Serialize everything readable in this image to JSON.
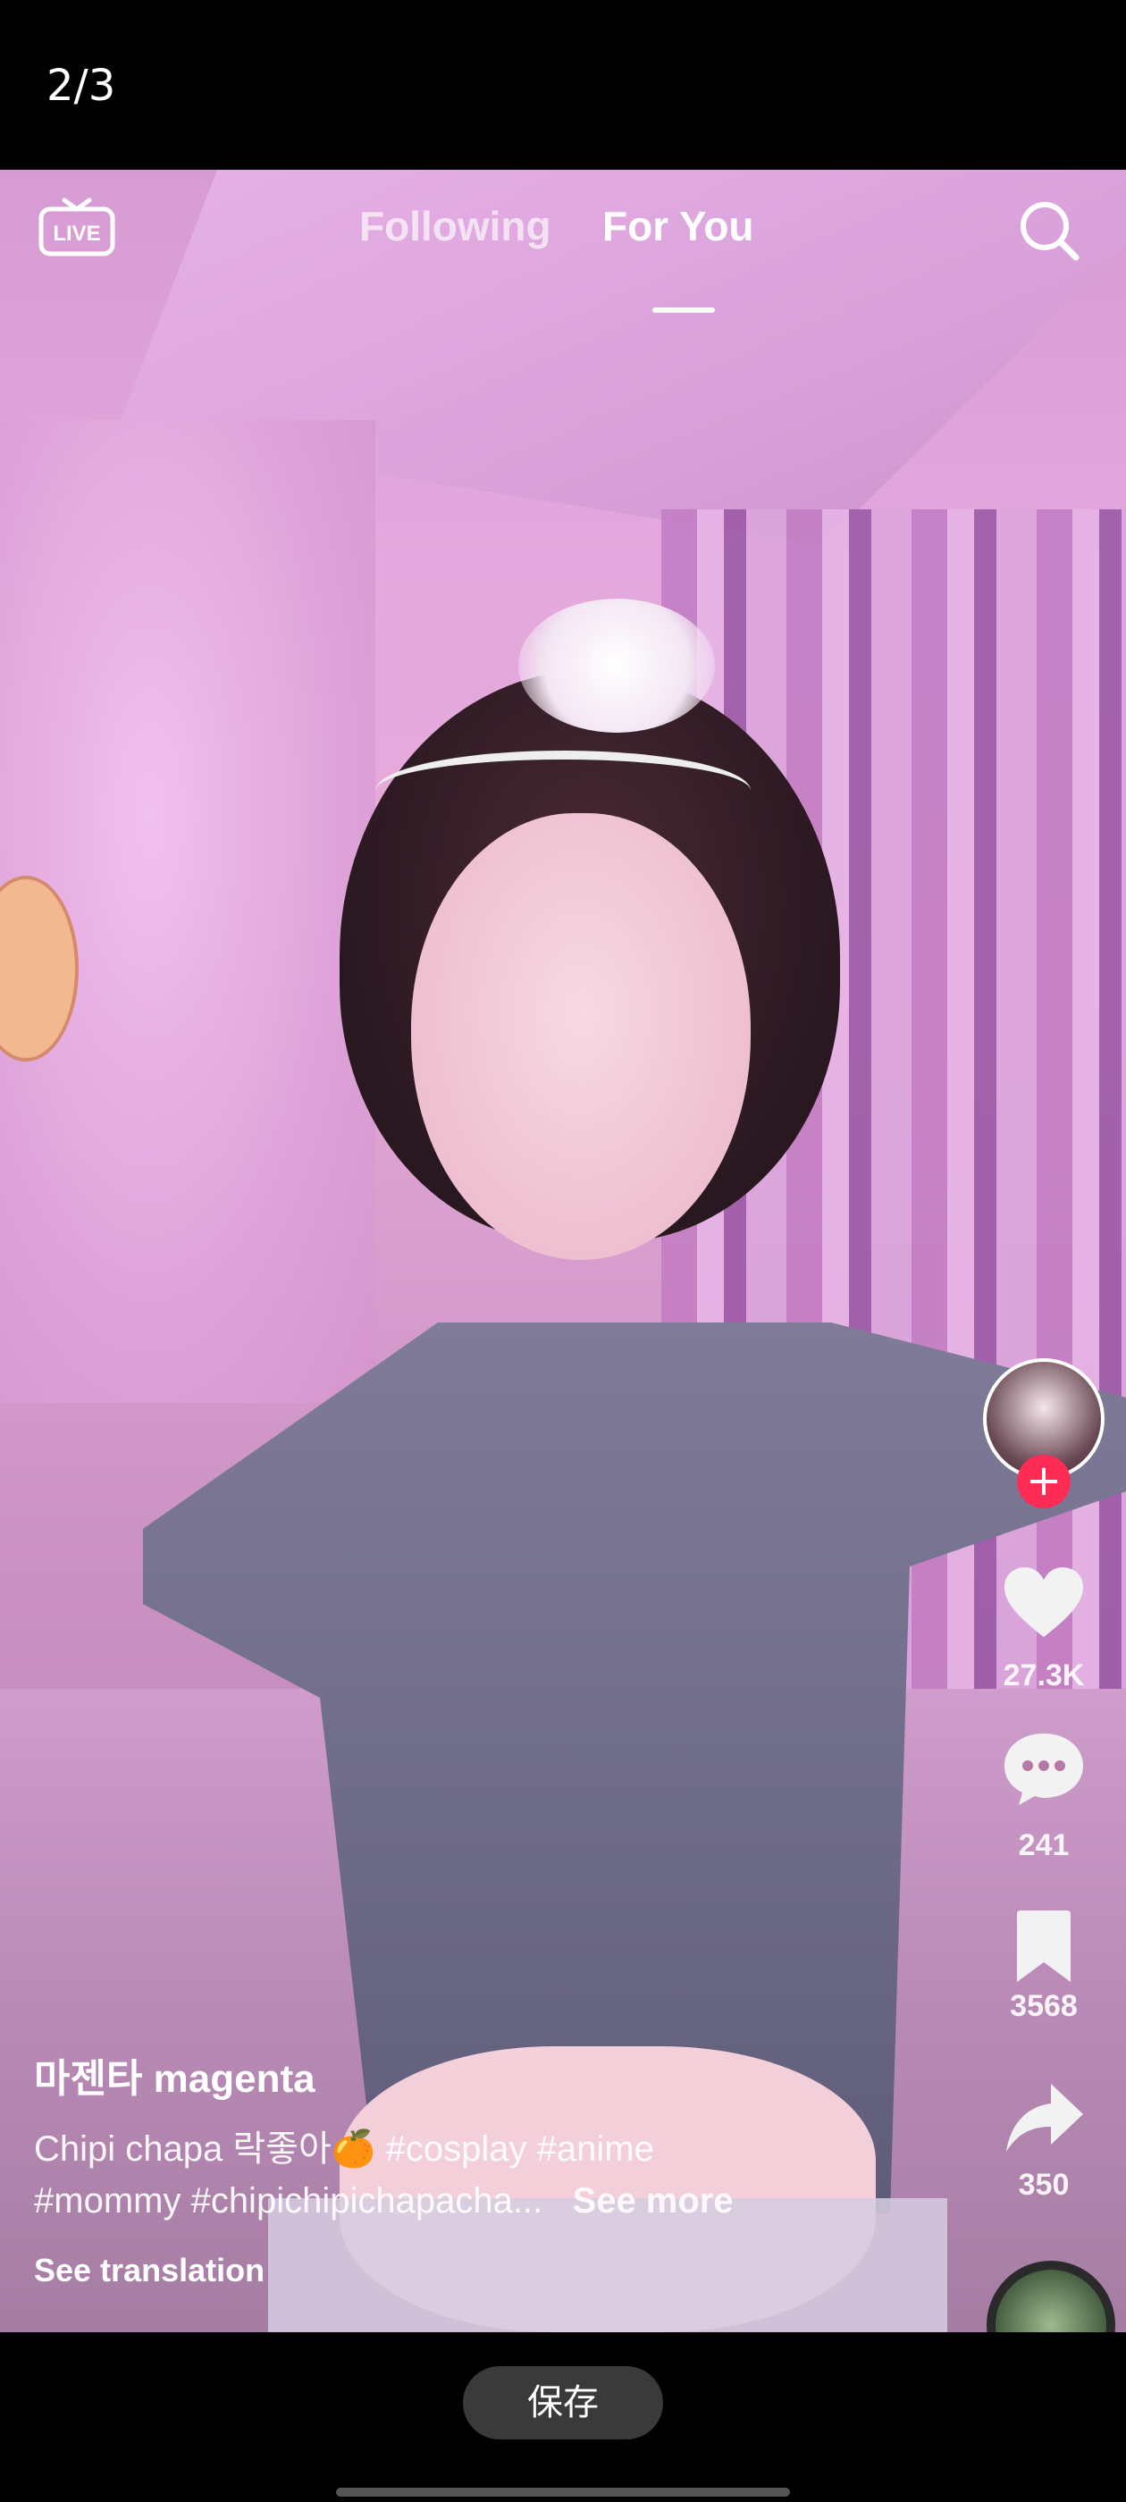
{
  "viewer": {
    "page_indicator": "2/3"
  },
  "video": {
    "tabs": [
      {
        "label": "Following",
        "active": false
      },
      {
        "label": "For You",
        "active": true
      }
    ],
    "live_label": "LIVE",
    "icons": {
      "live": "live-tv-icon",
      "search": "search-icon",
      "like": "heart-icon",
      "comment": "comment-icon",
      "bookmark": "bookmark-icon",
      "share": "share-arrow-icon"
    },
    "right_rail": {
      "likes": "27.3K",
      "comments": "241",
      "bookmarks": "3568",
      "shares": "350"
    },
    "username": "마젠타 magenta",
    "caption": {
      "text_line1": "Chipi chapa 락좋아🍊 #cosplay #anime",
      "text_line2": "#mommy #chipichipichapacha...",
      "see_more": "See more"
    },
    "see_translation": "See translation",
    "colors": {
      "follow_accent": "#fe2c55"
    }
  },
  "footer": {
    "save_label": "保存"
  }
}
